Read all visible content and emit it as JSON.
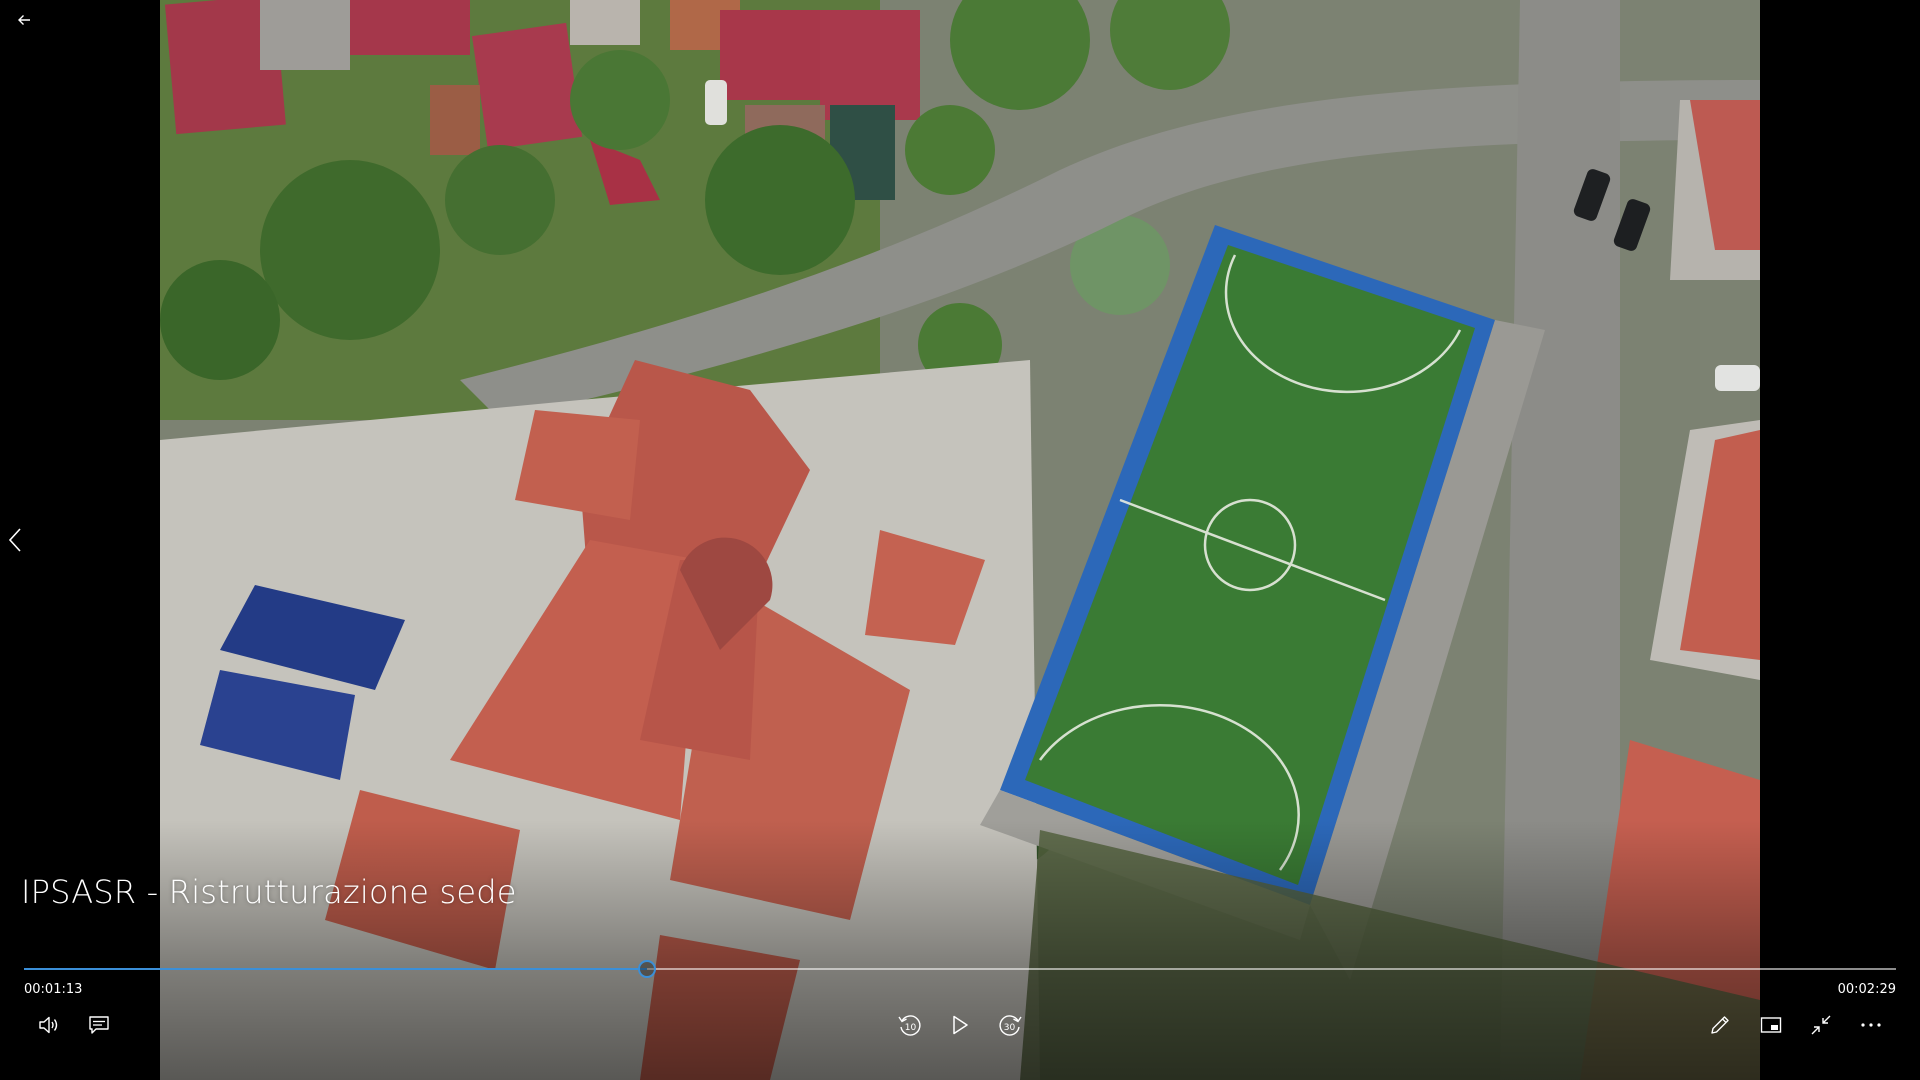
{
  "player": {
    "title": "IPSASR - Ristrutturazione sede",
    "time_elapsed": "00:01:13",
    "time_total": "00:02:29",
    "progress": 0.333,
    "skip_back_seconds": "10",
    "skip_forward_seconds": "30",
    "accent_color": "#3b8fd8"
  },
  "icons": {
    "back": "arrow-left-icon",
    "previous": "chevron-left-icon",
    "volume": "speaker-icon",
    "captions": "captions-icon",
    "skip_back": "rewind-10-icon",
    "play": "play-icon",
    "skip_forward": "forward-30-icon",
    "edit": "pencil-icon",
    "miniplayer": "miniplayer-icon",
    "exit_fullscreen": "exit-fullscreen-icon",
    "more": "more-dots-icon"
  }
}
